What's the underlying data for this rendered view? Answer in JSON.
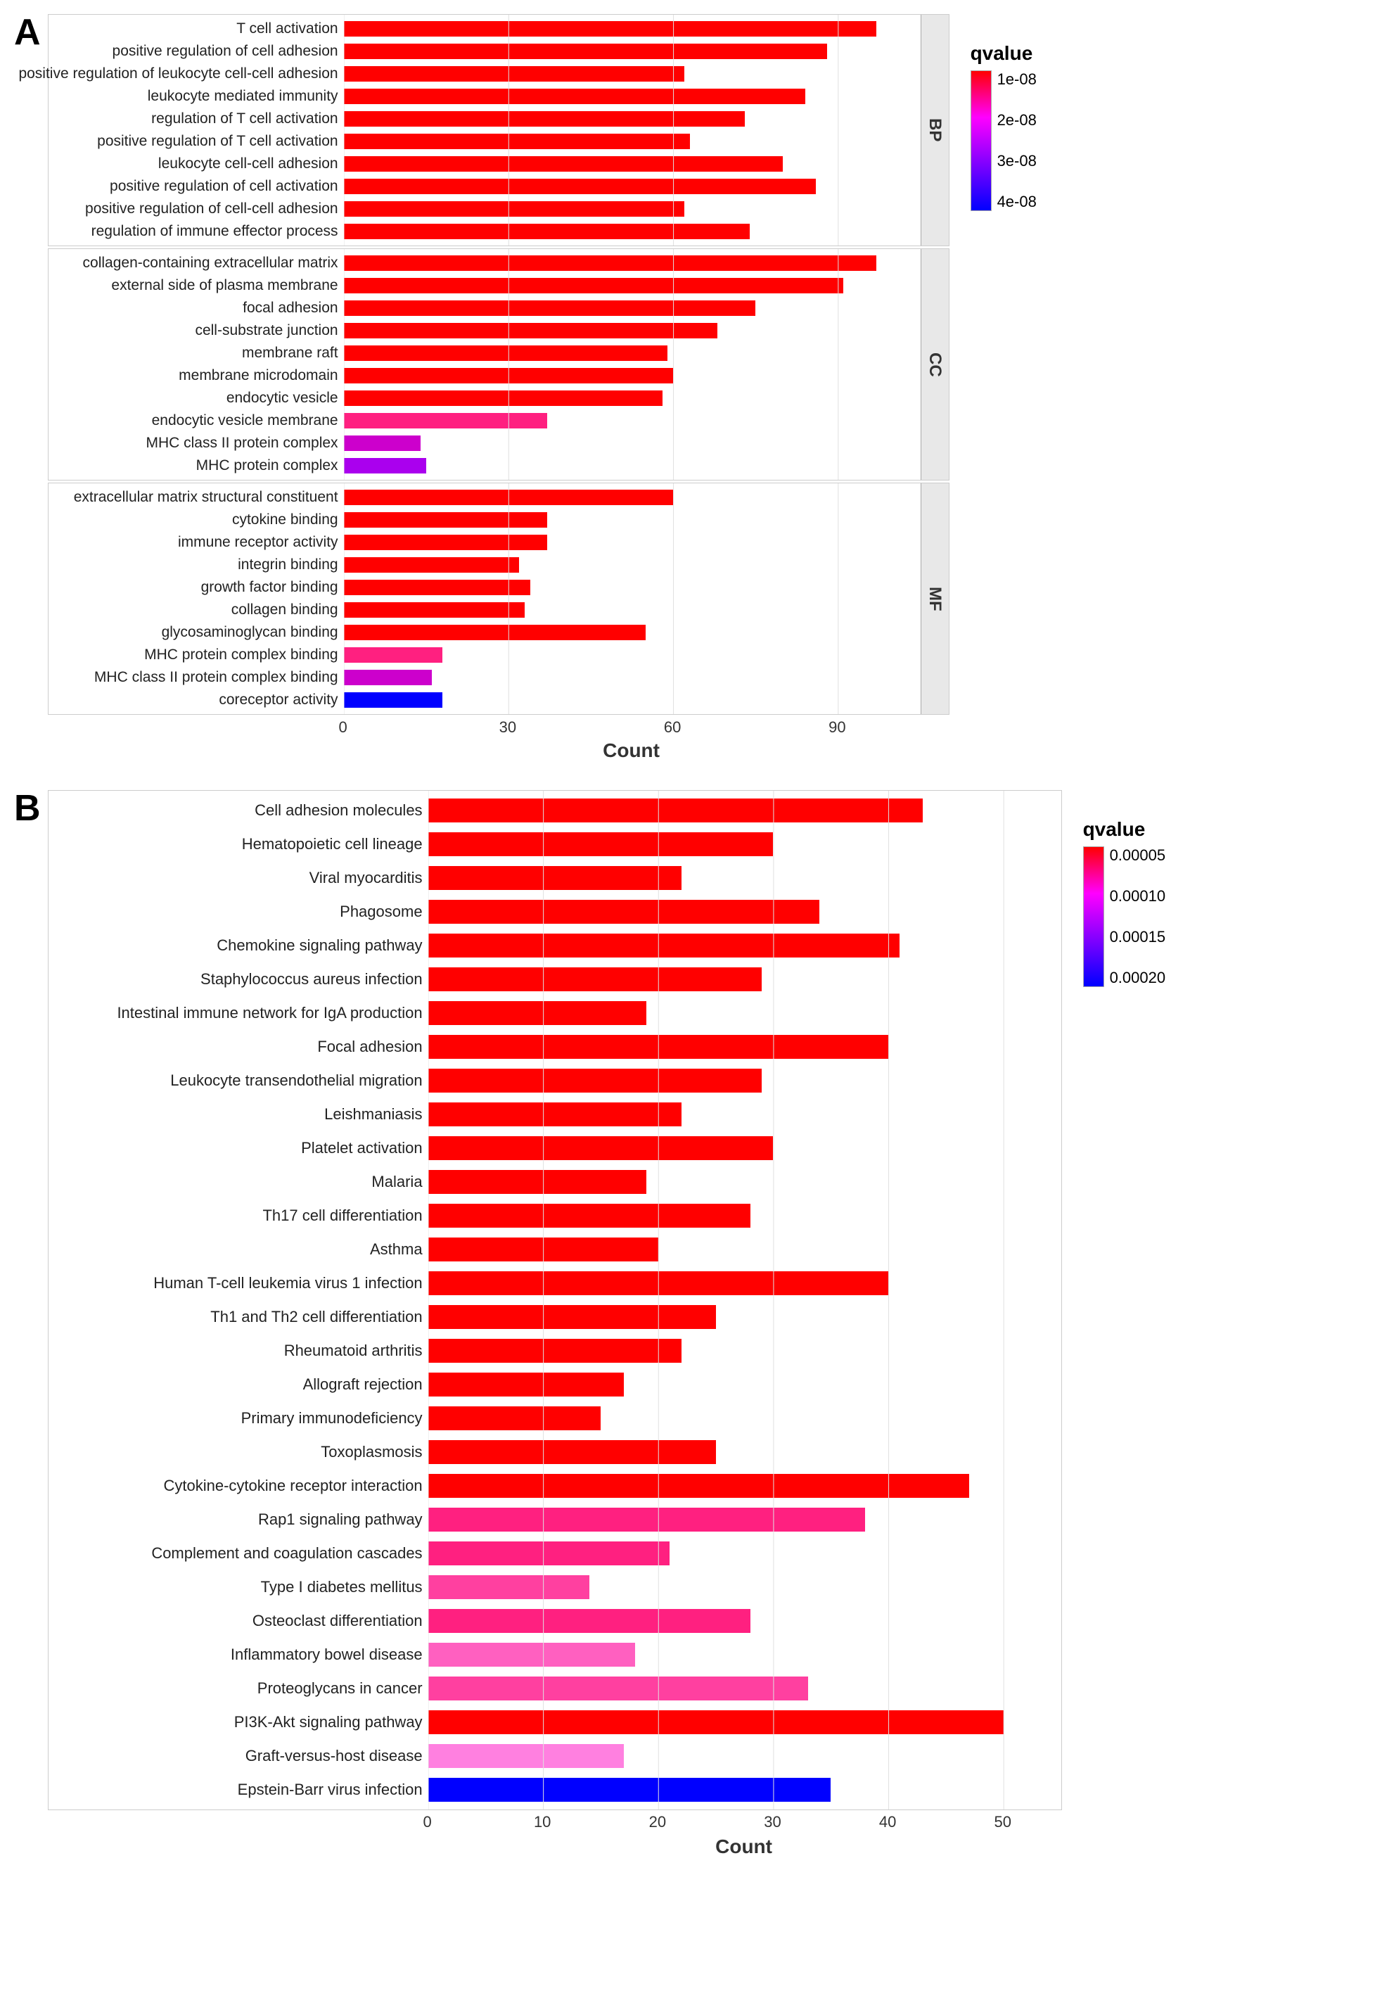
{
  "panelA": {
    "label": "A",
    "legend": {
      "title": "qvalue",
      "labels": [
        "1e-08",
        "2e-08",
        "3e-08",
        "4e-08"
      ]
    },
    "xAxis": {
      "title": "Count",
      "ticks": [
        0,
        30,
        60,
        90
      ],
      "max": 105
    },
    "groups": [
      {
        "id": "BP",
        "label": "BP",
        "items": [
          {
            "label": "T cell activation",
            "count": 97,
            "color": "#ff0000"
          },
          {
            "label": "positive regulation of cell adhesion",
            "count": 88,
            "color": "#ff0000"
          },
          {
            "label": "positive regulation of leukocyte cell-cell adhesion",
            "count": 62,
            "color": "#ff0000"
          },
          {
            "label": "leukocyte mediated immunity",
            "count": 84,
            "color": "#ff0000"
          },
          {
            "label": "regulation of T cell activation",
            "count": 73,
            "color": "#ff0000"
          },
          {
            "label": "positive regulation of T cell activation",
            "count": 63,
            "color": "#ff0000"
          },
          {
            "label": "leukocyte cell-cell adhesion",
            "count": 80,
            "color": "#ff0000"
          },
          {
            "label": "positive regulation of cell activation",
            "count": 86,
            "color": "#ff0000"
          },
          {
            "label": "positive regulation of cell-cell adhesion",
            "count": 62,
            "color": "#ff0000"
          },
          {
            "label": "regulation of immune effector process",
            "count": 74,
            "color": "#ff0000"
          }
        ]
      },
      {
        "id": "CC",
        "label": "CC",
        "items": [
          {
            "label": "collagen-containing extracellular matrix",
            "count": 97,
            "color": "#ff0000"
          },
          {
            "label": "external side of plasma membrane",
            "count": 91,
            "color": "#ff0000"
          },
          {
            "label": "focal adhesion",
            "count": 75,
            "color": "#ff0000"
          },
          {
            "label": "cell-substrate junction",
            "count": 68,
            "color": "#ff0000"
          },
          {
            "label": "membrane raft",
            "count": 59,
            "color": "#ff0000"
          },
          {
            "label": "membrane microdomain",
            "count": 60,
            "color": "#ff0000"
          },
          {
            "label": "endocytic vesicle",
            "count": 58,
            "color": "#ff0000"
          },
          {
            "label": "endocytic vesicle membrane",
            "count": 37,
            "color": "#ff2080"
          },
          {
            "label": "MHC class II protein complex",
            "count": 14,
            "color": "#cc00cc"
          },
          {
            "label": "MHC protein complex",
            "count": 15,
            "color": "#aa00ee"
          }
        ]
      },
      {
        "id": "MF",
        "label": "MF",
        "items": [
          {
            "label": "extracellular matrix structural constituent",
            "count": 60,
            "color": "#ff0000"
          },
          {
            "label": "cytokine binding",
            "count": 37,
            "color": "#ff0000"
          },
          {
            "label": "immune receptor activity",
            "count": 37,
            "color": "#ff0000"
          },
          {
            "label": "integrin binding",
            "count": 32,
            "color": "#ff0000"
          },
          {
            "label": "growth factor binding",
            "count": 34,
            "color": "#ff0000"
          },
          {
            "label": "collagen binding",
            "count": 33,
            "color": "#ff0000"
          },
          {
            "label": "glycosaminoglycan binding",
            "count": 55,
            "color": "#ff0000"
          },
          {
            "label": "MHC protein complex binding",
            "count": 18,
            "color": "#ff2080"
          },
          {
            "label": "MHC class II protein complex binding",
            "count": 16,
            "color": "#cc00cc"
          },
          {
            "label": "coreceptor activity",
            "count": 18,
            "color": "#0000ff"
          }
        ]
      }
    ]
  },
  "panelB": {
    "label": "B",
    "legend": {
      "title": "qvalue",
      "labels": [
        "0.00005",
        "0.00010",
        "0.00015",
        "0.00020"
      ]
    },
    "xAxis": {
      "title": "Count",
      "ticks": [
        0,
        10,
        20,
        30,
        40,
        50
      ],
      "max": 55
    },
    "items": [
      {
        "label": "Cell adhesion molecules",
        "count": 43,
        "color": "#ff0000"
      },
      {
        "label": "Hematopoietic cell lineage",
        "count": 30,
        "color": "#ff0000"
      },
      {
        "label": "Viral myocarditis",
        "count": 22,
        "color": "#ff0000"
      },
      {
        "label": "Phagosome",
        "count": 34,
        "color": "#ff0000"
      },
      {
        "label": "Chemokine signaling pathway",
        "count": 41,
        "color": "#ff0000"
      },
      {
        "label": "Staphylococcus aureus infection",
        "count": 29,
        "color": "#ff0000"
      },
      {
        "label": "Intestinal immune network for IgA production",
        "count": 19,
        "color": "#ff0000"
      },
      {
        "label": "Focal adhesion",
        "count": 40,
        "color": "#ff0000"
      },
      {
        "label": "Leukocyte transendothelial migration",
        "count": 29,
        "color": "#ff0000"
      },
      {
        "label": "Leishmaniasis",
        "count": 22,
        "color": "#ff0000"
      },
      {
        "label": "Platelet activation",
        "count": 30,
        "color": "#ff0000"
      },
      {
        "label": "Malaria",
        "count": 19,
        "color": "#ff0000"
      },
      {
        "label": "Th17 cell differentiation",
        "count": 28,
        "color": "#ff0000"
      },
      {
        "label": "Asthma",
        "count": 20,
        "color": "#ff0000"
      },
      {
        "label": "Human T-cell leukemia virus 1 infection",
        "count": 40,
        "color": "#ff0000"
      },
      {
        "label": "Th1 and Th2 cell differentiation",
        "count": 25,
        "color": "#ff0000"
      },
      {
        "label": "Rheumatoid arthritis",
        "count": 22,
        "color": "#ff0000"
      },
      {
        "label": "Allograft rejection",
        "count": 17,
        "color": "#ff0000"
      },
      {
        "label": "Primary immunodeficiency",
        "count": 15,
        "color": "#ff0000"
      },
      {
        "label": "Toxoplasmosis",
        "count": 25,
        "color": "#ff0000"
      },
      {
        "label": "Cytokine-cytokine receptor interaction",
        "count": 47,
        "color": "#ff0000"
      },
      {
        "label": "Rap1 signaling pathway",
        "count": 38,
        "color": "#ff2080"
      },
      {
        "label": "Complement and coagulation cascades",
        "count": 21,
        "color": "#ff2080"
      },
      {
        "label": "Type I diabetes mellitus",
        "count": 14,
        "color": "#ff40a0"
      },
      {
        "label": "Osteoclast differentiation",
        "count": 28,
        "color": "#ff2080"
      },
      {
        "label": "Inflammatory bowel disease",
        "count": 18,
        "color": "#ff60c0"
      },
      {
        "label": "Proteoglycans in cancer",
        "count": 33,
        "color": "#ff40a0"
      },
      {
        "label": "PI3K-Akt signaling pathway",
        "count": 50,
        "color": "#ff0000"
      },
      {
        "label": "Graft-versus-host disease",
        "count": 17,
        "color": "#ff80e0"
      },
      {
        "label": "Epstein-Barr virus infection",
        "count": 35,
        "color": "#0000ff"
      }
    ]
  }
}
